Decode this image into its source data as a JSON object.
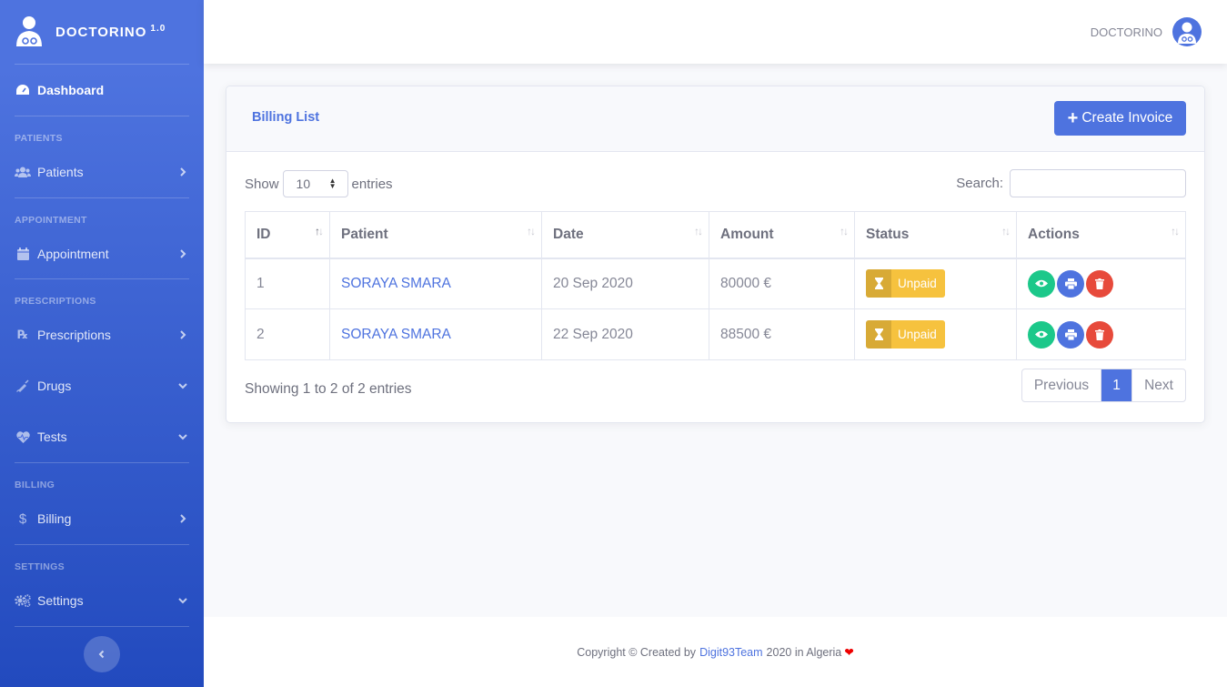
{
  "brand": {
    "name": "DOCTORINO",
    "version": "1.0"
  },
  "sidebar": {
    "dashboard": "Dashboard",
    "headings": {
      "patients": "PATIENTS",
      "appointment": "APPOINTMENT",
      "prescriptions": "PRESCRIPTIONS",
      "billing": "BILLING",
      "settings": "SETTINGS"
    },
    "items": {
      "patients": "Patients",
      "appointment": "Appointment",
      "prescriptions": "Prescriptions",
      "drugs": "Drugs",
      "tests": "Tests",
      "billing": "Billing",
      "settings": "Settings"
    }
  },
  "topbar": {
    "user_name": "DOCTORINO"
  },
  "card": {
    "title": "Billing List",
    "create_button": "Create Invoice",
    "show_label": "Show",
    "entries_label": "entries",
    "page_size": "10",
    "search_label": "Search:",
    "columns": [
      "ID",
      "Patient",
      "Date",
      "Amount",
      "Status",
      "Actions"
    ],
    "rows": [
      {
        "id": "1",
        "patient": "SORAYA SMARA",
        "date": "20 Sep 2020",
        "amount": "80000 €",
        "status": "Unpaid"
      },
      {
        "id": "2",
        "patient": "SORAYA SMARA",
        "date": "22 Sep 2020",
        "amount": "88500 €",
        "status": "Unpaid"
      }
    ],
    "info": "Showing 1 to 2 of 2 entries",
    "pager": {
      "previous": "Previous",
      "current": "1",
      "next": "Next"
    }
  },
  "footer": {
    "prefix": "Copyright © Created by",
    "link": "Digit93Team",
    "suffix": "2020 in Algeria"
  },
  "colors": {
    "primary": "#4e73df",
    "success": "#1cc88a",
    "danger": "#e74a3b",
    "warning": "#f6c23e"
  }
}
